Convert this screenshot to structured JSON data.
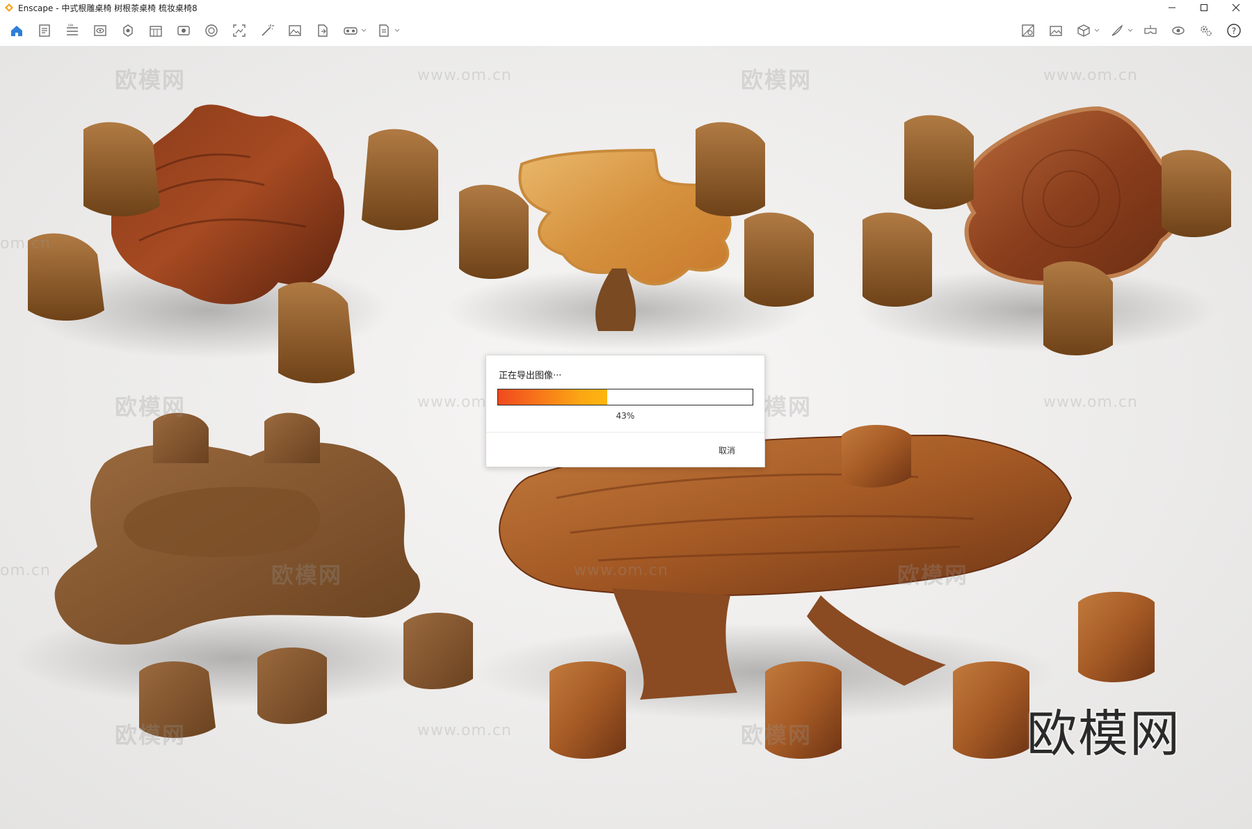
{
  "window": {
    "app_name": "Enscape",
    "title": "Enscape - 中式根雕桌椅 树根茶桌椅 梳妆桌椅8",
    "controls": [
      "minimize",
      "maximize",
      "close"
    ]
  },
  "toolbar": {
    "left_icons": [
      "home-icon",
      "document-icon",
      "layers-icon",
      "view-icon",
      "sun-icon",
      "calendar-icon",
      "panorama-icon",
      "globe-icon",
      "capture-icon",
      "magic-wand-icon",
      "image-icon",
      "export-file-icon",
      "vr-headset-icon",
      "batch-render-icon"
    ],
    "right_icons": [
      "material-icon",
      "image-gallery-icon",
      "asset-library-icon",
      "brush-icon",
      "vr-view-icon",
      "visual-settings-icon",
      "settings-icon",
      "help-icon"
    ]
  },
  "watermarks": {
    "brand": "欧模网",
    "url": "www.om.cn",
    "url_fragment": "om.cn",
    "big": "欧模网"
  },
  "export_dialog": {
    "message": "正在导出图像···",
    "progress_fraction": 0.43,
    "progress_label": "43%",
    "cancel_label": "取消"
  },
  "colors": {
    "accent_orange": "#f47e1d",
    "accent_yellow": "#fdb610",
    "toolbar_icon": "#6b6b6b",
    "home_icon": "#2f7fd8"
  }
}
